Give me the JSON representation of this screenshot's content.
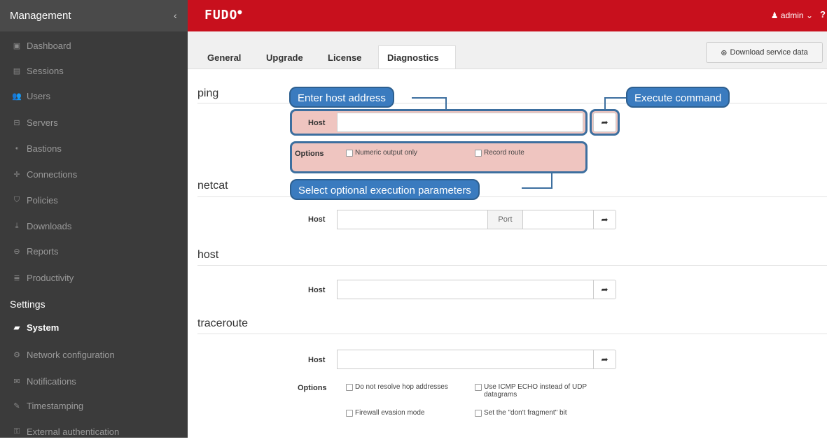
{
  "sidebar": {
    "title": "Management",
    "collapse_icon": "‹",
    "items": [
      {
        "label": "Dashboard",
        "icon": "dashboard-icon",
        "glyph": "▣"
      },
      {
        "label": "Sessions",
        "icon": "sessions-icon",
        "glyph": "▤"
      },
      {
        "label": "Users",
        "icon": "users-icon",
        "glyph": "👥"
      },
      {
        "label": "Servers",
        "icon": "servers-icon",
        "glyph": "⊟"
      },
      {
        "label": "Bastions",
        "icon": "bastions-icon",
        "glyph": "⁌"
      },
      {
        "label": "Connections",
        "icon": "connections-icon",
        "glyph": "✛"
      },
      {
        "label": "Policies",
        "icon": "policies-icon",
        "glyph": "⛉"
      },
      {
        "label": "Downloads",
        "icon": "downloads-icon",
        "glyph": "⤓"
      },
      {
        "label": "Reports",
        "icon": "reports-icon",
        "glyph": "⊖"
      },
      {
        "label": "Productivity",
        "icon": "productivity-icon",
        "glyph": "≣"
      }
    ],
    "settings_label": "Settings",
    "settings_items": [
      {
        "label": "System",
        "icon": "folder-open-icon",
        "glyph": "▰",
        "active": true
      },
      {
        "label": "Network configuration",
        "icon": "cogs-icon",
        "glyph": "⚙"
      },
      {
        "label": "Notifications",
        "icon": "envelope-icon",
        "glyph": "✉"
      },
      {
        "label": "Timestamping",
        "icon": "edit-icon",
        "glyph": "✎"
      },
      {
        "label": "External authentication",
        "icon": "key-icon",
        "glyph": "⚿"
      }
    ]
  },
  "topbar": {
    "logo": "FUDO",
    "user": "admin",
    "user_icon": "user-icon",
    "caret": "⌄",
    "help": "?"
  },
  "tabs": {
    "items": [
      "General",
      "Upgrade",
      "License",
      "Diagnostics"
    ],
    "active": "Diagnostics",
    "download_label": "Download service data",
    "download_icon": "download-icon"
  },
  "ping": {
    "title": "ping",
    "host_label": "Host",
    "host_value": "",
    "options_label": "Options",
    "options": [
      "Numeric output only",
      "Record route"
    ]
  },
  "netcat": {
    "title": "netcat",
    "host_label": "Host",
    "host_value": "",
    "port_label": "Port",
    "port_value": ""
  },
  "host": {
    "title": "host",
    "host_label": "Host",
    "host_value": ""
  },
  "traceroute": {
    "title": "traceroute",
    "host_label": "Host",
    "host_value": "",
    "options_label": "Options",
    "options": [
      "Do not resolve hop addresses",
      "Use ICMP ECHO instead of UDP datagrams",
      "Firewall evasion mode",
      "Set the \"don't fragment\" bit"
    ]
  },
  "callouts": {
    "host": "Enter host address",
    "execute": "Execute command",
    "options": "Select optional execution parameters"
  },
  "execute_icon": "share-arrow-icon",
  "colors": {
    "brand_red": "#c8101d",
    "sidebar_bg": "#3b3b3b",
    "callout_blue": "#3a7bbf",
    "highlight": "#e1968c"
  }
}
